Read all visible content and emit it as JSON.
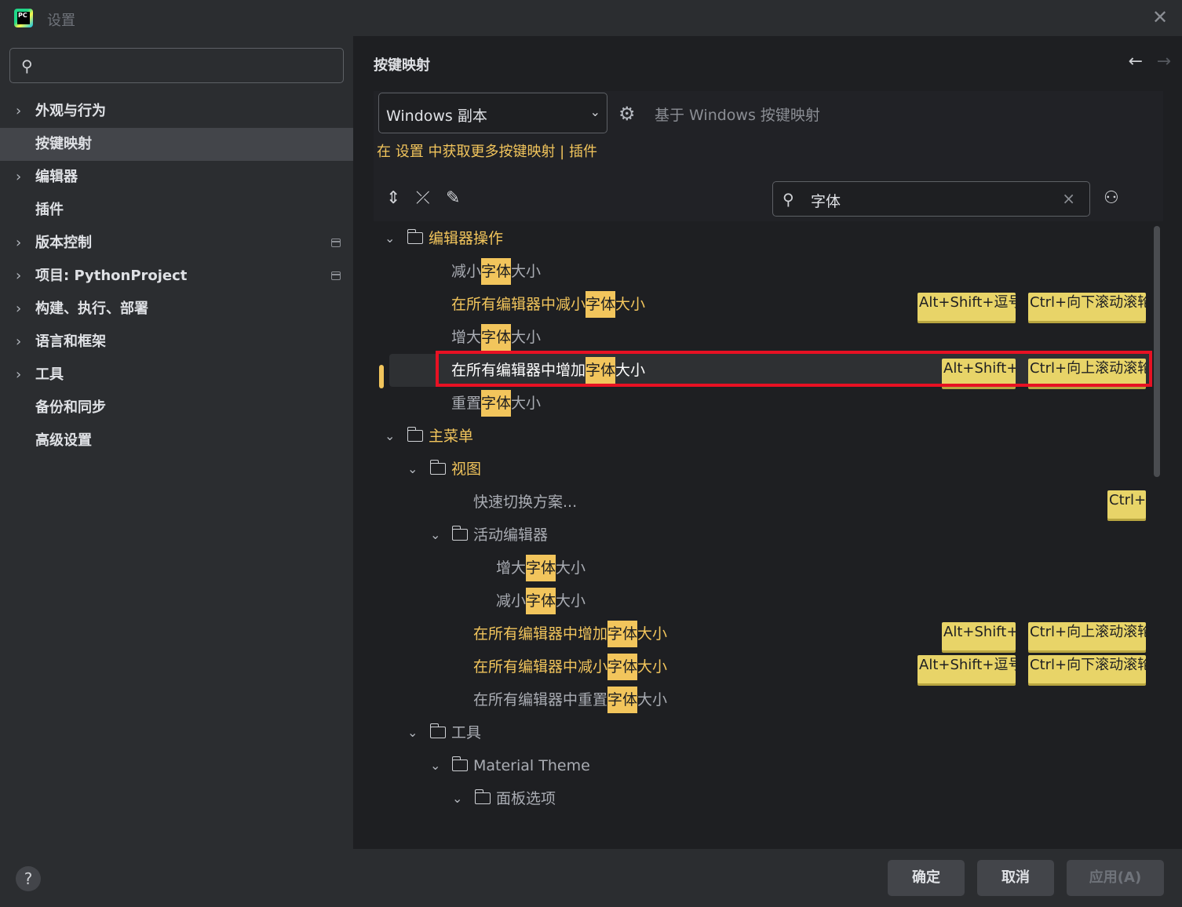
{
  "window": {
    "title": "设置",
    "logo_text": "PC"
  },
  "sidebar": {
    "search": {
      "value": ""
    },
    "items": [
      {
        "label": "外观与行为",
        "expandable": true
      },
      {
        "label": "按键映射",
        "expandable": false,
        "selected": true
      },
      {
        "label": "编辑器",
        "expandable": true
      },
      {
        "label": "插件",
        "expandable": false
      },
      {
        "label": "版本控制",
        "expandable": true,
        "project_icon": true
      },
      {
        "label": "项目: PythonProject",
        "expandable": true,
        "project_icon": true
      },
      {
        "label": "构建、执行、部署",
        "expandable": true
      },
      {
        "label": "语言和框架",
        "expandable": true
      },
      {
        "label": "工具",
        "expandable": true
      },
      {
        "label": "备份和同步",
        "expandable": false
      },
      {
        "label": "高级设置",
        "expandable": false
      }
    ]
  },
  "main": {
    "title": "按键映射",
    "keymap_select": "Windows 副本",
    "based_on": "基于 Windows 按键映射",
    "link_text": "在 设置 中获取更多按键映射 | 插件",
    "search": {
      "value": "字体"
    },
    "tree": {
      "r0": {
        "label": "编辑器操作"
      },
      "r1": {
        "pre": "减小",
        "hl": "字体",
        "post": "大小"
      },
      "r2": {
        "pre": "在所有编辑器中减小",
        "hl": "字体",
        "post": "大小",
        "k1": "Alt+Shift+逗号",
        "k2": "Ctrl+向下滚动滚轮"
      },
      "r3": {
        "pre": "增大",
        "hl": "字体",
        "post": "大小"
      },
      "r4": {
        "pre": "在所有编辑器中增加",
        "hl": "字体",
        "post": "大小",
        "k1": "Alt+Shift+.",
        "k2": "Ctrl+向上滚动滚轮"
      },
      "r5": {
        "pre": "重置",
        "hl": "字体",
        "post": "大小"
      },
      "r6": {
        "label": "主菜单"
      },
      "r7": {
        "label": "视图"
      },
      "r8": {
        "label": "快速切换方案...",
        "k1": "Ctrl+`"
      },
      "r9": {
        "label": "活动编辑器"
      },
      "r10": {
        "pre": "增大",
        "hl": "字体",
        "post": "大小"
      },
      "r11": {
        "pre": "减小",
        "hl": "字体",
        "post": "大小"
      },
      "r12": {
        "pre": "在所有编辑器中增加",
        "hl": "字体",
        "post": "大小",
        "k1": "Alt+Shift+.",
        "k2": "Ctrl+向上滚动滚轮"
      },
      "r13": {
        "pre": "在所有编辑器中减小",
        "hl": "字体",
        "post": "大小",
        "k1": "Alt+Shift+逗号",
        "k2": "Ctrl+向下滚动滚轮"
      },
      "r14": {
        "pre": "在所有编辑器中重置",
        "hl": "字体",
        "post": "大小"
      },
      "r15": {
        "label": "工具"
      },
      "r16": {
        "label": "Material Theme"
      },
      "r17": {
        "label": "面板选项"
      }
    }
  },
  "footer": {
    "help": "?",
    "ok": "确定",
    "cancel": "取消",
    "apply": "应用(A)"
  },
  "colors": {
    "accent": "#f2c55c",
    "highlight_border": "#e81123",
    "background": "#1e1f22",
    "panel": "#2b2d30"
  }
}
